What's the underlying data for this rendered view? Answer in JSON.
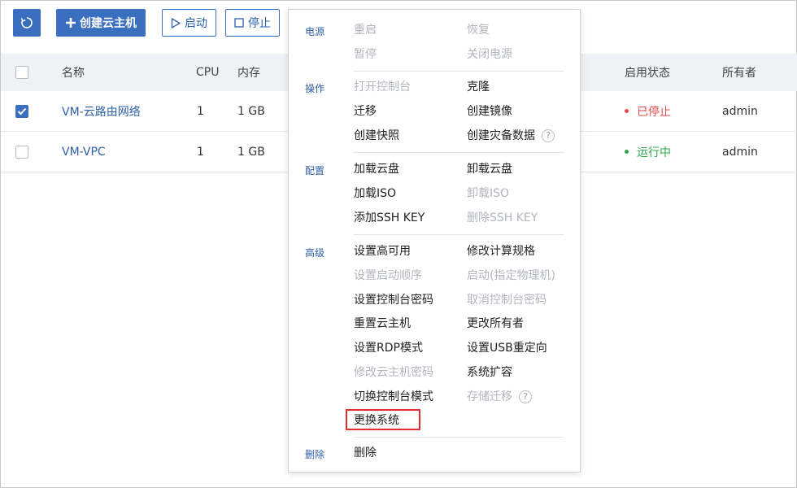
{
  "toolbar": {
    "create_label": "创建云主机",
    "start_label": "启动",
    "stop_label": "停止"
  },
  "table": {
    "headers": {
      "name": "名称",
      "cpu": "CPU",
      "memory": "内存",
      "state": "启用状态",
      "owner": "所有者"
    },
    "rows": [
      {
        "name": "VM-云路由网络",
        "cpu": "1",
        "memory": "1 GB",
        "state": "已停止",
        "owner": "admin",
        "checked": true
      },
      {
        "name": "VM-VPC",
        "cpu": "1",
        "memory": "1 GB",
        "state": "运行中",
        "owner": "admin",
        "checked": false
      }
    ]
  },
  "menu": {
    "sections": [
      {
        "label": "电源",
        "items": [
          "重启",
          "恢复",
          "暂停",
          "关闭电源"
        ]
      },
      {
        "label": "操作",
        "items": [
          "打开控制台",
          "克隆",
          "迁移",
          "创建镜像",
          "创建快照",
          "创建灾备数据"
        ]
      },
      {
        "label": "配置",
        "items": [
          "加载云盘",
          "卸载云盘",
          "加载ISO",
          "卸载ISO",
          "添加SSH KEY",
          "删除SSH KEY"
        ]
      },
      {
        "label": "高级",
        "items": [
          "设置高可用",
          "修改计算规格",
          "设置启动顺序",
          "启动(指定物理机)",
          "设置控制台密码",
          "取消控制台密码",
          "重置云主机",
          "更改所有者",
          "设置RDP模式",
          "设置USB重定向",
          "修改云主机密码",
          "系统扩容",
          "切换控制台模式",
          "存储迁移",
          "更换系统"
        ]
      },
      {
        "label": "删除",
        "items": [
          "删除"
        ]
      }
    ]
  },
  "colors": {
    "accent": "#3a6fbf",
    "stopped": "#e44a4a",
    "running": "#2fa750",
    "highlight": "#e52d2d",
    "disabled": "#b2b6bd"
  }
}
